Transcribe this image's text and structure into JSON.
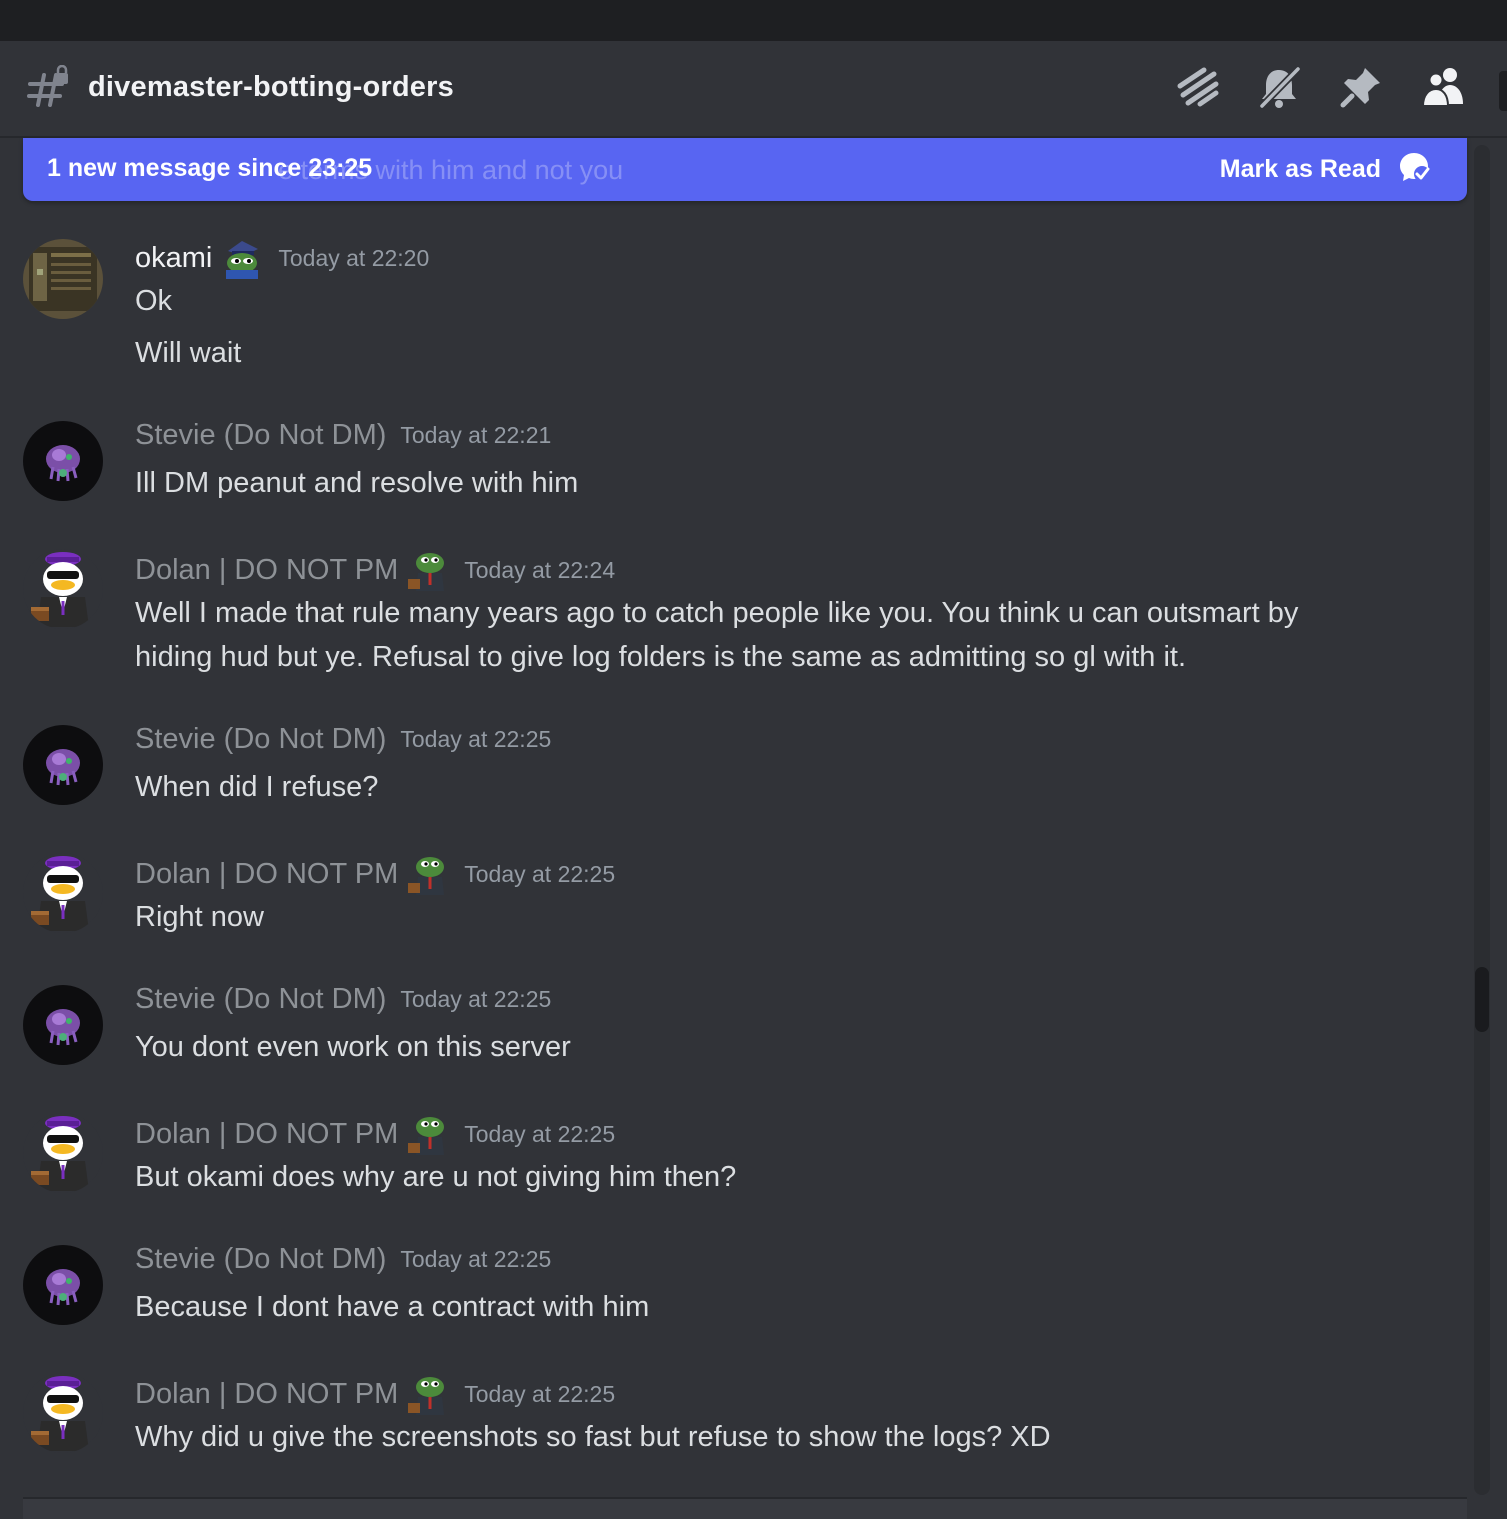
{
  "channel": {
    "name": "divemaster-botting-orders",
    "icon": "hash-lock-icon"
  },
  "header_actions": [
    {
      "name": "threads-icon"
    },
    {
      "name": "notification-muted-icon"
    },
    {
      "name": "pin-icon"
    },
    {
      "name": "member-list-icon"
    }
  ],
  "banner": {
    "text": "1 new message since 23:25",
    "ghost_text": "e terms with him and not you",
    "mark_label": "Mark as Read",
    "mark_icon": "mark-read-icon",
    "color": "#5865f2"
  },
  "messages": [
    {
      "author": "okami",
      "timestamp": "Today at 22:20",
      "lines": [
        "Ok",
        "Will wait"
      ]
    },
    {
      "author": "Stevie (Do Not DM)",
      "timestamp": "Today at 22:21",
      "lines": [
        "Ill DM peanut and resolve with him"
      ]
    },
    {
      "author": "Dolan | DO NOT PM",
      "timestamp": "Today at 22:24",
      "lines": [
        "Well I made that rule many years ago to catch people like you. You think u can outsmart by",
        "hiding hud but ye. Refusal to give log folders is the same as admitting so gl with it."
      ]
    },
    {
      "author": "Stevie (Do Not DM)",
      "timestamp": "Today at 22:25",
      "lines": [
        "When did I refuse?"
      ]
    },
    {
      "author": "Dolan | DO NOT PM",
      "timestamp": "Today at 22:25",
      "lines": [
        "Right now"
      ]
    },
    {
      "author": "Stevie (Do Not DM)",
      "timestamp": "Today at 22:25",
      "lines": [
        "You dont even work on this server"
      ]
    },
    {
      "author": "Dolan | DO NOT PM",
      "timestamp": "Today at 22:25",
      "lines": [
        "But okami does why are u not giving him then?"
      ]
    },
    {
      "author": "Stevie (Do Not DM)",
      "timestamp": "Today at 22:25",
      "lines": [
        "Because I dont have a contract with him"
      ]
    },
    {
      "author": "Dolan | DO NOT PM",
      "timestamp": "Today at 22:25",
      "lines": [
        "Why did u give the screenshots so fast but refuse to show the logs? XD"
      ]
    }
  ]
}
